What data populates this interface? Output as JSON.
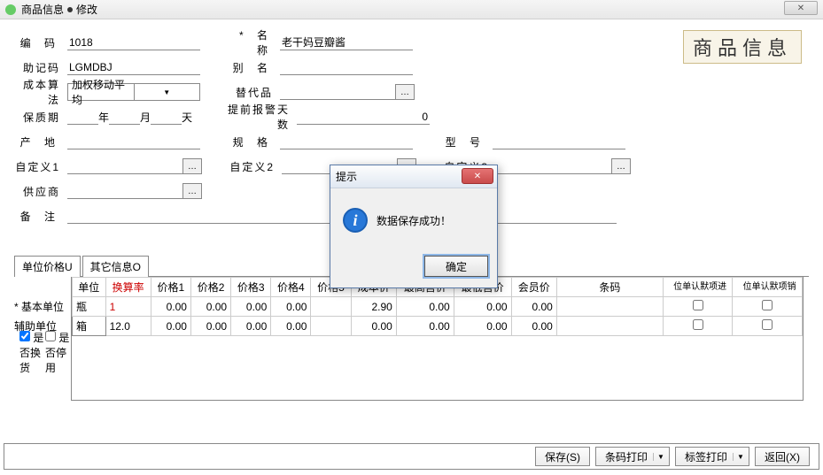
{
  "window": {
    "title": "商品信息",
    "mode": "修改"
  },
  "header_banner": "商品信息",
  "form": {
    "code_label": "编  码",
    "code_value": "1018",
    "mn_label": "助记码",
    "mn_value": "LGMDBJ",
    "cost_label": "成本算法",
    "cost_value": "加权移动平均",
    "shelf_label": "保质期",
    "shelf_y": "年",
    "shelf_m": "月",
    "shelf_d": "天",
    "origin_label": "产  地",
    "custom1_label": "自定义1",
    "supplier_label": "供应商",
    "remark_label": "备  注",
    "name_label": "* 名  称",
    "name_value": "老干妈豆瓣酱",
    "alias_label": "别  名",
    "sub_label": "替代品",
    "prewarn_label": "提前报警天数",
    "prewarn_value": "0",
    "spec_label": "规  格",
    "custom2_label": "自定义2",
    "model_label": "型  号",
    "custom3_label": "自定义3"
  },
  "tabs": {
    "t1": "单位价格U",
    "t2": "其它信息O"
  },
  "grid": {
    "side_base": "* 基本单位",
    "side_aux": "辅助单位",
    "headers": {
      "unit": "单位",
      "rate": "换算率",
      "p1": "价格1",
      "p2": "价格2",
      "p3": "价格3",
      "p4": "价格4",
      "p5": "价格5",
      "cost": "成本价",
      "high": "最高售价",
      "low": "最低售价",
      "member": "会员价",
      "barcode": "条码",
      "in_unit": "进项默认单位",
      "out_unit": "销项默认单位"
    },
    "rows": [
      {
        "unit": "瓶",
        "rate": "1",
        "p1": "0.00",
        "p2": "0.00",
        "p3": "0.00",
        "p4": "0.00",
        "cost": "2.90",
        "high": "0.00",
        "low": "0.00",
        "member": "0.00",
        "barcode": "",
        "in": false,
        "out": false
      },
      {
        "unit": "箱",
        "rate": "12.0",
        "p1": "0.00",
        "p2": "0.00",
        "p3": "0.00",
        "p4": "0.00",
        "cost": "0.00",
        "high": "0.00",
        "low": "0.00",
        "member": "0.00",
        "barcode": "",
        "in": false,
        "out": false
      }
    ]
  },
  "checks": {
    "exchange": "是否换货",
    "disable": "是否停用"
  },
  "buttons": {
    "save": "保存(S)",
    "barcode_print": "条码打印",
    "label_print": "标签打印",
    "back": "返回(X)"
  },
  "dialog": {
    "title": "提示",
    "message": "数据保存成功！",
    "ok": "确定"
  }
}
